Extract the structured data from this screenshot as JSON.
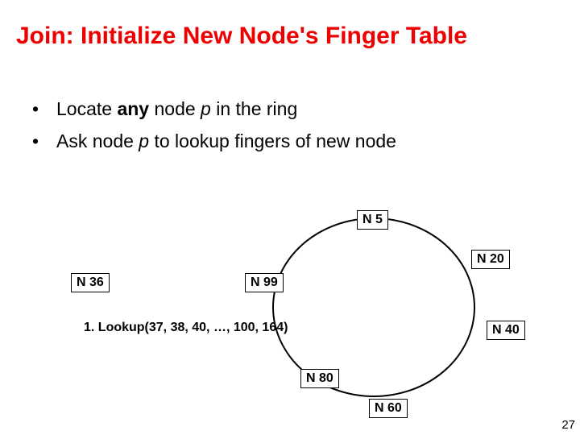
{
  "title": "Join: Initialize New Node's Finger Table",
  "bullets": {
    "b1_pre": "Locate ",
    "b1_bold": "any",
    "b1_mid": " node ",
    "b1_italic": "p",
    "b1_post": " in the ring",
    "b2_pre": " Ask node ",
    "b2_italic": "p",
    "b2_post": " to lookup fingers of new node"
  },
  "nodes": {
    "n5": "N 5",
    "n20": "N 20",
    "n36": "N 36",
    "n40": "N 40",
    "n60": "N 60",
    "n80": "N 80",
    "n99": "N 99"
  },
  "step": "1. Lookup(37, 38, 40, …, 100, 164)",
  "page": "27"
}
